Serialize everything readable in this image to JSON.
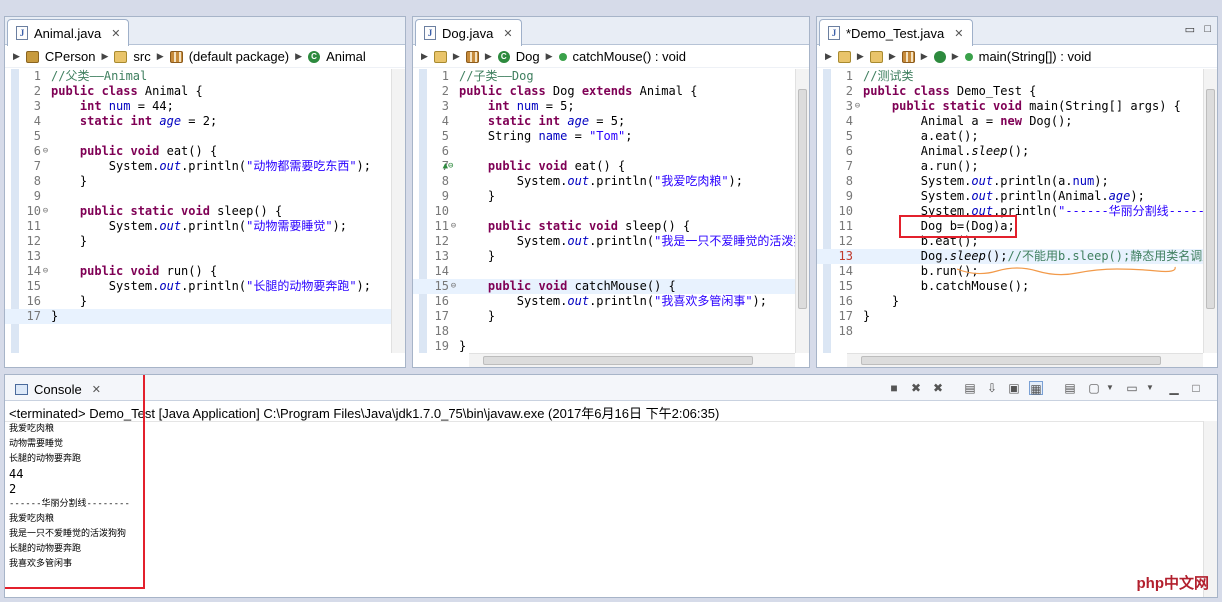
{
  "editors": [
    {
      "tab_title": "Animal.java",
      "breadcrumb": [
        "CPerson",
        "src",
        "(default package)",
        "Animal"
      ],
      "lines": [
        {
          "n": "1",
          "f": "",
          "segs": [
            {
              "t": "//父类——Animal",
              "c": "c"
            }
          ]
        },
        {
          "n": "2",
          "f": "",
          "segs": [
            {
              "t": "public class ",
              "c": "k"
            },
            {
              "t": "Animal {",
              "c": ""
            }
          ]
        },
        {
          "n": "3",
          "f": "",
          "segs": [
            {
              "t": "    int ",
              "c": "k"
            },
            {
              "t": "num",
              "c": "f"
            },
            {
              "t": " = 44;",
              "c": ""
            }
          ]
        },
        {
          "n": "4",
          "f": "",
          "segs": [
            {
              "t": "    static int ",
              "c": "k"
            },
            {
              "t": "age",
              "c": "fi"
            },
            {
              "t": " = 2;",
              "c": ""
            }
          ]
        },
        {
          "n": "5",
          "f": "",
          "segs": []
        },
        {
          "n": "6",
          "f": "⊖",
          "segs": [
            {
              "t": "    public void ",
              "c": "k"
            },
            {
              "t": "eat() {",
              "c": ""
            }
          ]
        },
        {
          "n": "7",
          "f": "",
          "segs": [
            {
              "t": "        System.",
              "c": ""
            },
            {
              "t": "out",
              "c": "fi"
            },
            {
              "t": ".println(",
              "c": ""
            },
            {
              "t": "\"动物都需要吃东西\"",
              "c": "s"
            },
            {
              "t": ");",
              "c": ""
            }
          ]
        },
        {
          "n": "8",
          "f": "",
          "segs": [
            {
              "t": "    }",
              "c": ""
            }
          ]
        },
        {
          "n": "9",
          "f": "",
          "segs": []
        },
        {
          "n": "10",
          "f": "⊖",
          "segs": [
            {
              "t": "    public static void ",
              "c": "k"
            },
            {
              "t": "sleep() {",
              "c": ""
            }
          ]
        },
        {
          "n": "11",
          "f": "",
          "segs": [
            {
              "t": "        System.",
              "c": ""
            },
            {
              "t": "out",
              "c": "fi"
            },
            {
              "t": ".println(",
              "c": ""
            },
            {
              "t": "\"动物需要睡觉\"",
              "c": "s"
            },
            {
              "t": ");",
              "c": ""
            }
          ]
        },
        {
          "n": "12",
          "f": "",
          "segs": [
            {
              "t": "    }",
              "c": ""
            }
          ]
        },
        {
          "n": "13",
          "f": "",
          "segs": []
        },
        {
          "n": "14",
          "f": "⊖",
          "segs": [
            {
              "t": "    public void ",
              "c": "k"
            },
            {
              "t": "run() {",
              "c": ""
            }
          ]
        },
        {
          "n": "15",
          "f": "",
          "segs": [
            {
              "t": "        System.",
              "c": ""
            },
            {
              "t": "out",
              "c": "fi"
            },
            {
              "t": ".println(",
              "c": ""
            },
            {
              "t": "\"长腿的动物要奔跑\"",
              "c": "s"
            },
            {
              "t": ");",
              "c": ""
            }
          ]
        },
        {
          "n": "16",
          "f": "",
          "segs": [
            {
              "t": "    }",
              "c": ""
            }
          ]
        },
        {
          "n": "17",
          "f": "",
          "segs": [
            {
              "t": "}",
              "c": ""
            }
          ],
          "hl": true
        }
      ]
    },
    {
      "tab_title": "Dog.java",
      "breadcrumb": [
        "",
        "",
        "Dog",
        "catchMouse() : void"
      ],
      "lines": [
        {
          "n": "1",
          "f": "",
          "segs": [
            {
              "t": "//子类——Dog",
              "c": "c"
            }
          ]
        },
        {
          "n": "2",
          "f": "",
          "segs": [
            {
              "t": "public class ",
              "c": "k"
            },
            {
              "t": "Dog ",
              "c": ""
            },
            {
              "t": "extends ",
              "c": "k"
            },
            {
              "t": "Animal {",
              "c": ""
            }
          ]
        },
        {
          "n": "3",
          "f": "",
          "segs": [
            {
              "t": "    int ",
              "c": "k"
            },
            {
              "t": "num",
              "c": "f"
            },
            {
              "t": " = 5;",
              "c": ""
            }
          ]
        },
        {
          "n": "4",
          "f": "",
          "segs": [
            {
              "t": "    static int ",
              "c": "k"
            },
            {
              "t": "age",
              "c": "fi"
            },
            {
              "t": " = 5;",
              "c": ""
            }
          ]
        },
        {
          "n": "5",
          "f": "",
          "segs": [
            {
              "t": "    String ",
              "c": ""
            },
            {
              "t": "name",
              "c": "f"
            },
            {
              "t": " = ",
              "c": ""
            },
            {
              "t": "\"Tom\"",
              "c": "s"
            },
            {
              "t": ";",
              "c": ""
            }
          ]
        },
        {
          "n": "6",
          "f": "",
          "segs": []
        },
        {
          "n": "7",
          "f": "▲⊖",
          "segs": [
            {
              "t": "    public void ",
              "c": "k"
            },
            {
              "t": "eat() {",
              "c": ""
            }
          ]
        },
        {
          "n": "8",
          "f": "",
          "segs": [
            {
              "t": "        System.",
              "c": ""
            },
            {
              "t": "out",
              "c": "fi"
            },
            {
              "t": ".println(",
              "c": ""
            },
            {
              "t": "\"我爱吃肉粮\"",
              "c": "s"
            },
            {
              "t": ");",
              "c": ""
            }
          ]
        },
        {
          "n": "9",
          "f": "",
          "segs": [
            {
              "t": "    }",
              "c": ""
            }
          ]
        },
        {
          "n": "10",
          "f": "",
          "segs": []
        },
        {
          "n": "11",
          "f": "⊖",
          "segs": [
            {
              "t": "    public static void ",
              "c": "k"
            },
            {
              "t": "sleep() {",
              "c": ""
            }
          ]
        },
        {
          "n": "12",
          "f": "",
          "segs": [
            {
              "t": "        System.",
              "c": ""
            },
            {
              "t": "out",
              "c": "fi"
            },
            {
              "t": ".println(",
              "c": ""
            },
            {
              "t": "\"我是一只不爱睡觉的活泼狗狗\"",
              "c": "s"
            },
            {
              "t": ")",
              "c": ""
            }
          ]
        },
        {
          "n": "13",
          "f": "",
          "segs": [
            {
              "t": "    }",
              "c": ""
            }
          ]
        },
        {
          "n": "14",
          "f": "",
          "segs": []
        },
        {
          "n": "15",
          "f": "⊖",
          "segs": [
            {
              "t": "    public void ",
              "c": "k"
            },
            {
              "t": "catchMouse() {",
              "c": ""
            }
          ],
          "hl": true
        },
        {
          "n": "16",
          "f": "",
          "segs": [
            {
              "t": "        System.",
              "c": ""
            },
            {
              "t": "out",
              "c": "fi"
            },
            {
              "t": ".println(",
              "c": ""
            },
            {
              "t": "\"我喜欢多管闲事\"",
              "c": "s"
            },
            {
              "t": ");",
              "c": ""
            }
          ]
        },
        {
          "n": "17",
          "f": "",
          "segs": [
            {
              "t": "    }",
              "c": ""
            }
          ]
        },
        {
          "n": "18",
          "f": "",
          "segs": []
        },
        {
          "n": "19",
          "f": "",
          "segs": [
            {
              "t": "}",
              "c": ""
            }
          ]
        }
      ]
    },
    {
      "tab_title": "*Demo_Test.java",
      "breadcrumb": [
        "",
        "",
        "",
        "",
        "main(String[]) : void"
      ],
      "lines": [
        {
          "n": "1",
          "f": "",
          "segs": [
            {
              "t": "//测试类",
              "c": "c"
            }
          ]
        },
        {
          "n": "2",
          "f": "",
          "segs": [
            {
              "t": "public class ",
              "c": "k"
            },
            {
              "t": "Demo_Test {",
              "c": ""
            }
          ]
        },
        {
          "n": "3",
          "f": "⊖",
          "segs": [
            {
              "t": "    public static void ",
              "c": "k"
            },
            {
              "t": "main(String[] args) {",
              "c": ""
            }
          ]
        },
        {
          "n": "4",
          "f": "",
          "segs": [
            {
              "t": "        Animal a = ",
              "c": ""
            },
            {
              "t": "new ",
              "c": "k"
            },
            {
              "t": "Dog();",
              "c": ""
            }
          ]
        },
        {
          "n": "5",
          "f": "",
          "segs": [
            {
              "t": "        a.eat();",
              "c": ""
            }
          ]
        },
        {
          "n": "6",
          "f": "",
          "segs": [
            {
              "t": "        Animal.",
              "c": ""
            },
            {
              "t": "sleep",
              "c": "i"
            },
            {
              "t": "();",
              "c": ""
            }
          ]
        },
        {
          "n": "7",
          "f": "",
          "segs": [
            {
              "t": "        a.run();",
              "c": ""
            }
          ]
        },
        {
          "n": "8",
          "f": "",
          "segs": [
            {
              "t": "        System.",
              "c": ""
            },
            {
              "t": "out",
              "c": "fi"
            },
            {
              "t": ".println(a.",
              "c": ""
            },
            {
              "t": "num",
              "c": "f"
            },
            {
              "t": ");",
              "c": ""
            }
          ]
        },
        {
          "n": "9",
          "f": "",
          "segs": [
            {
              "t": "        System.",
              "c": ""
            },
            {
              "t": "out",
              "c": "fi"
            },
            {
              "t": ".println(Animal.",
              "c": ""
            },
            {
              "t": "age",
              "c": "fi"
            },
            {
              "t": ");",
              "c": ""
            }
          ]
        },
        {
          "n": "10",
          "f": "",
          "segs": [
            {
              "t": "        System.",
              "c": ""
            },
            {
              "t": "out",
              "c": "fi"
            },
            {
              "t": ".println(",
              "c": ""
            },
            {
              "t": "\"------华丽分割线------",
              "c": "s"
            }
          ]
        },
        {
          "n": "11",
          "f": "",
          "segs": [
            {
              "t": "        Dog b=(Dog)a;",
              "c": ""
            }
          ]
        },
        {
          "n": "12",
          "f": "",
          "segs": [
            {
              "t": "        b.eat();",
              "c": ""
            }
          ]
        },
        {
          "n": "13",
          "f": "",
          "segs": [
            {
              "t": "        Dog.",
              "c": ""
            },
            {
              "t": "sleep",
              "c": "i"
            },
            {
              "t": "();",
              "c": ""
            },
            {
              "t": "//不能用b.sleep();静态用类名调用",
              "c": "c"
            }
          ],
          "hl": true
        },
        {
          "n": "14",
          "f": "",
          "segs": [
            {
              "t": "        b.run();",
              "c": ""
            }
          ]
        },
        {
          "n": "15",
          "f": "",
          "segs": [
            {
              "t": "        b.catchMouse();",
              "c": ""
            }
          ]
        },
        {
          "n": "16",
          "f": "",
          "segs": [
            {
              "t": "    }",
              "c": ""
            }
          ]
        },
        {
          "n": "17",
          "f": "",
          "segs": [
            {
              "t": "}",
              "c": ""
            }
          ]
        },
        {
          "n": "18",
          "f": "",
          "segs": []
        }
      ]
    }
  ],
  "console": {
    "tab_title": "Console",
    "terminated_line": "<terminated> Demo_Test [Java Application] C:\\Program Files\\Java\\jdk1.7.0_75\\bin\\javaw.exe (2017年6月16日 下午2:06:35)",
    "output": [
      {
        "t": "我爱吃肉粮",
        "big": false
      },
      {
        "t": "动物需要睡觉",
        "big": false
      },
      {
        "t": "长腿的动物要奔跑",
        "big": false
      },
      {
        "t": "44",
        "big": true
      },
      {
        "t": "2",
        "big": true
      },
      {
        "t": "------华丽分割线--------",
        "big": false
      },
      {
        "t": "我爱吃肉粮",
        "big": false
      },
      {
        "t": "我是一只不爱睡觉的活泼狗狗",
        "big": false
      },
      {
        "t": "长腿的动物要奔跑",
        "big": false
      },
      {
        "t": "我喜欢多管闲事",
        "big": false
      }
    ]
  },
  "watermark": "php中文网",
  "colors": {
    "annotation_red": "#e3202c",
    "keyword": "#7f0055",
    "string": "#2a00ff",
    "comment": "#3f7f5f",
    "field": "#0000c0"
  }
}
